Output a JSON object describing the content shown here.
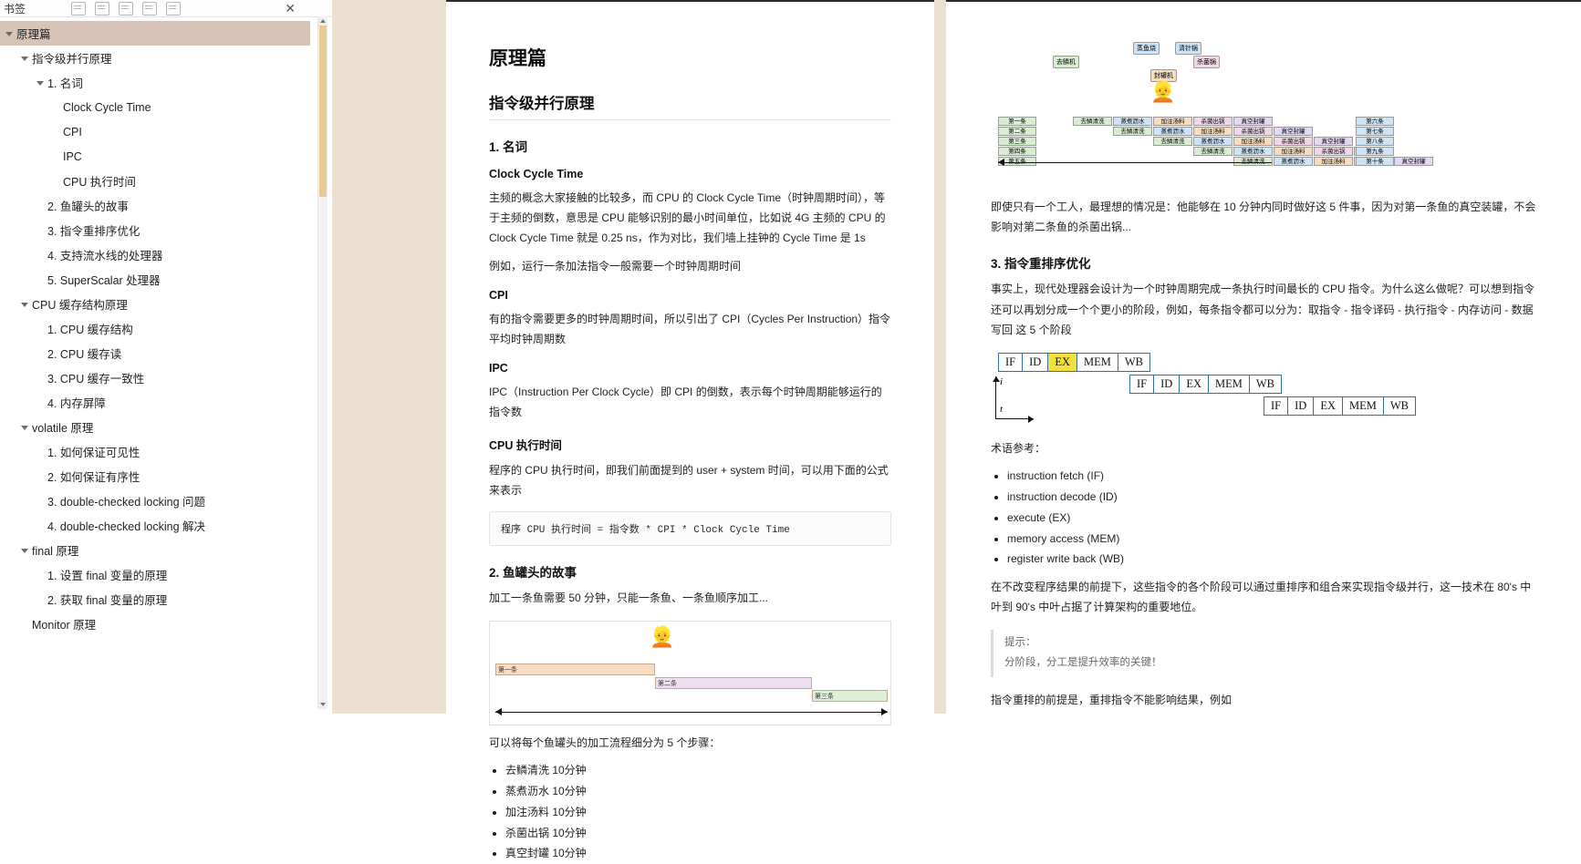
{
  "bookmark_panel": {
    "title": "书签",
    "close_icon": "close-icon",
    "toolbar_icons": [
      "expand-icon",
      "collapse-icon",
      "add-bookmark-icon",
      "edit-bookmark-icon",
      "delete-bookmark-icon"
    ],
    "items": [
      {
        "label": "原理篇",
        "indent": 0,
        "twisty": true,
        "selected": true
      },
      {
        "label": "指令级并行原理",
        "indent": 1,
        "twisty": true,
        "selected": false
      },
      {
        "label": "1. 名词",
        "indent": 2,
        "twisty": true,
        "selected": false
      },
      {
        "label": "Clock Cycle Time",
        "indent": 3,
        "twisty": false,
        "selected": false
      },
      {
        "label": "CPI",
        "indent": 3,
        "twisty": false,
        "selected": false
      },
      {
        "label": "IPC",
        "indent": 3,
        "twisty": false,
        "selected": false
      },
      {
        "label": "CPU 执行时间",
        "indent": 3,
        "twisty": false,
        "selected": false
      },
      {
        "label": "2. 鱼罐头的故事",
        "indent": 2,
        "twisty": false,
        "selected": false
      },
      {
        "label": "3. 指令重排序优化",
        "indent": 2,
        "twisty": false,
        "selected": false
      },
      {
        "label": "4. 支持流水线的处理器",
        "indent": 2,
        "twisty": false,
        "selected": false
      },
      {
        "label": "5. SuperScalar 处理器",
        "indent": 2,
        "twisty": false,
        "selected": false
      },
      {
        "label": "CPU 缓存结构原理",
        "indent": 1,
        "twisty": true,
        "selected": false
      },
      {
        "label": "1. CPU 缓存结构",
        "indent": 2,
        "twisty": false,
        "selected": false
      },
      {
        "label": "2. CPU 缓存读",
        "indent": 2,
        "twisty": false,
        "selected": false
      },
      {
        "label": "3. CPU 缓存一致性",
        "indent": 2,
        "twisty": false,
        "selected": false
      },
      {
        "label": "4. 内存屏障",
        "indent": 2,
        "twisty": false,
        "selected": false
      },
      {
        "label": "volatile 原理",
        "indent": 1,
        "twisty": true,
        "selected": false
      },
      {
        "label": "1. 如何保证可见性",
        "indent": 2,
        "twisty": false,
        "selected": false
      },
      {
        "label": "2. 如何保证有序性",
        "indent": 2,
        "twisty": false,
        "selected": false
      },
      {
        "label": "3. double-checked locking 问题",
        "indent": 2,
        "twisty": false,
        "selected": false
      },
      {
        "label": "4. double-checked locking 解决",
        "indent": 2,
        "twisty": false,
        "selected": false
      },
      {
        "label": "final 原理",
        "indent": 1,
        "twisty": true,
        "selected": false
      },
      {
        "label": "1. 设置 final 变量的原理",
        "indent": 2,
        "twisty": false,
        "selected": false
      },
      {
        "label": "2. 获取 final 变量的原理",
        "indent": 2,
        "twisty": false,
        "selected": false
      },
      {
        "label": "Monitor 原理",
        "indent": 1,
        "twisty": false,
        "selected": false
      }
    ]
  },
  "page1": {
    "h1": "原理篇",
    "h2": "指令级并行原理",
    "s1_h3": "1. 名词",
    "s1_h4_a": "Clock Cycle Time",
    "s1_p_a": "主频的概念大家接触的比较多，而 CPU 的 Clock Cycle Time（时钟周期时间），等于主频的倒数，意思是 CPU 能够识别的最小时间单位，比如说 4G 主频的 CPU 的 Clock Cycle Time 就是 0.25 ns，作为对比，我们墙上挂钟的 Cycle Time 是 1s",
    "s1_p_b": "例如，运行一条加法指令一般需要一个时钟周期时间",
    "s1_h4_b": "CPI",
    "s1_p_c": "有的指令需要更多的时钟周期时间，所以引出了 CPI（Cycles Per Instruction）指令平均时钟周期数",
    "s1_h4_c": "IPC",
    "s1_p_d": "IPC（Instruction Per Clock Cycle）即 CPI 的倒数，表示每个时钟周期能够运行的指令数",
    "s1_h4_d": "CPU 执行时间",
    "s1_p_e": "程序的 CPU 执行时间，即我们前面提到的 user + system 时间，可以用下面的公式来表示",
    "s1_code": "程序 CPU 执行时间 = 指令数 * CPI * Clock Cycle Time",
    "s2_h3": "2. 鱼罐头的故事",
    "s2_p_a": "加工一条鱼需要 50 分钟，只能一条鱼、一条鱼顺序加工...",
    "s2_p_b": "可以将每个鱼罐头的加工流程细分为 5 个步骤：",
    "s2_list": [
      "去鳞清洗 10分钟",
      "蒸煮沥水 10分钟",
      "加注汤料 10分钟",
      "杀菌出锅 10分钟",
      "真空封罐 10分钟"
    ],
    "gantt": {
      "bars": [
        {
          "label": "第一条",
          "color": "orange"
        },
        {
          "label": "第二条",
          "color": "purple"
        },
        {
          "label": "第三条",
          "color": "green"
        }
      ]
    }
  },
  "page2": {
    "fig1": {
      "top_nodes": [
        {
          "label": "蒸鱼烧",
          "color": "blue"
        },
        {
          "label": "清针锅",
          "color": "blue"
        },
        {
          "label": "去鳞机",
          "color": "green"
        },
        {
          "label": "杀菌锅",
          "color": "pink"
        },
        {
          "label": "封罐机",
          "color": "orange"
        }
      ],
      "left_labels": [
        "第一条",
        "第二条",
        "第三条",
        "第四条",
        "第五条"
      ],
      "right_labels": [
        "第六条",
        "第七条",
        "第八条",
        "第九条",
        "第十条"
      ],
      "steps": [
        "去鳞清洗",
        "蒸煮沥水",
        "加注汤料",
        "杀菌出锅",
        "真空封罐"
      ]
    },
    "fig1_caption": "即使只有一个工人，最理想的情况是：他能够在 10 分钟内同时做好这 5 件事，因为对第一条鱼的真空装罐，不会影响对第二条鱼的杀菌出锅...",
    "s3_h3": "3. 指令重排序优化",
    "s3_p_a": "事实上，现代处理器会设计为一个时钟周期完成一条执行时间最长的 CPU 指令。为什么这么做呢？可以想到指令还可以再划分成一个个更小的阶段，例如，每条指令都可以分为：取指令 - 指令译码 - 执行指令 - 内存访问 - 数据写回 这 5 个阶段",
    "pipeline": {
      "rows": [
        {
          "stages": [
            "IF",
            "ID",
            "EX",
            "MEM",
            "WB"
          ],
          "highlight": "EX"
        },
        {
          "stages": [
            "IF",
            "ID",
            "EX",
            "MEM",
            "WB"
          ],
          "highlight": ""
        },
        {
          "stages": [
            "IF",
            "ID",
            "EX",
            "MEM",
            "WB"
          ],
          "highlight": ""
        }
      ],
      "axis_i": "i",
      "axis_t": "t"
    },
    "terms_title": "术语参考：",
    "terms": [
      "instruction fetch (IF)",
      "instruction decode (ID)",
      "execute (EX)",
      "memory access (MEM)",
      "register write back (WB)"
    ],
    "s3_p_b": "在不改变程序结果的前提下，这些指令的各个阶段可以通过重排序和组合来实现指令级并行，这一技术在 80's 中叶到 90's 中叶占据了计算架构的重要地位。",
    "note_title": "提示：",
    "note_body": "分阶段，分工是提升效率的关键！",
    "s3_p_c": "指令重排的前提是，重排指令不能影响结果，例如"
  }
}
